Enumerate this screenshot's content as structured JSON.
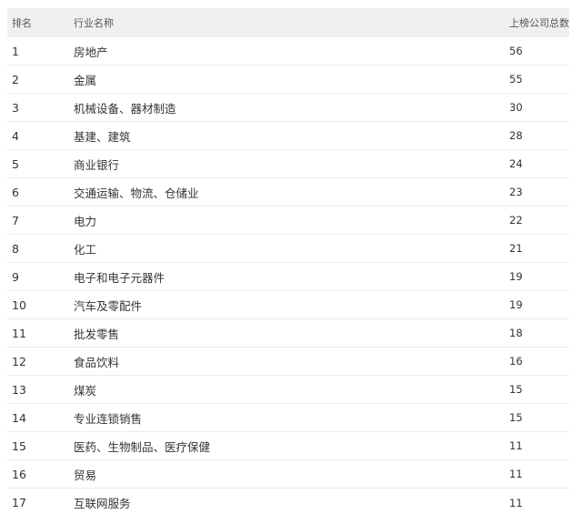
{
  "table": {
    "headers": {
      "rank": "排名",
      "industry": "行业名称",
      "count": "上榜公司总数"
    },
    "rows": [
      {
        "rank": "1",
        "industry": "房地产",
        "count": "56"
      },
      {
        "rank": "2",
        "industry": "金属",
        "count": "55"
      },
      {
        "rank": "3",
        "industry": "机械设备、器材制造",
        "count": "30"
      },
      {
        "rank": "4",
        "industry": "基建、建筑",
        "count": "28"
      },
      {
        "rank": "5",
        "industry": "商业银行",
        "count": "24"
      },
      {
        "rank": "6",
        "industry": "交通运输、物流、仓储业",
        "count": "23"
      },
      {
        "rank": "7",
        "industry": "电力",
        "count": "22"
      },
      {
        "rank": "8",
        "industry": "化工",
        "count": "21"
      },
      {
        "rank": "9",
        "industry": "电子和电子元器件",
        "count": "19"
      },
      {
        "rank": "10",
        "industry": "汽车及零配件",
        "count": "19"
      },
      {
        "rank": "11",
        "industry": "批发零售",
        "count": "18"
      },
      {
        "rank": "12",
        "industry": "食品饮料",
        "count": "16"
      },
      {
        "rank": "13",
        "industry": "煤炭",
        "count": "15"
      },
      {
        "rank": "14",
        "industry": "专业连锁销售",
        "count": "15"
      },
      {
        "rank": "15",
        "industry": "医药、生物制品、医疗保健",
        "count": "11"
      },
      {
        "rank": "16",
        "industry": "贸易",
        "count": "11"
      },
      {
        "rank": "17",
        "industry": "互联网服务",
        "count": "11"
      }
    ]
  }
}
